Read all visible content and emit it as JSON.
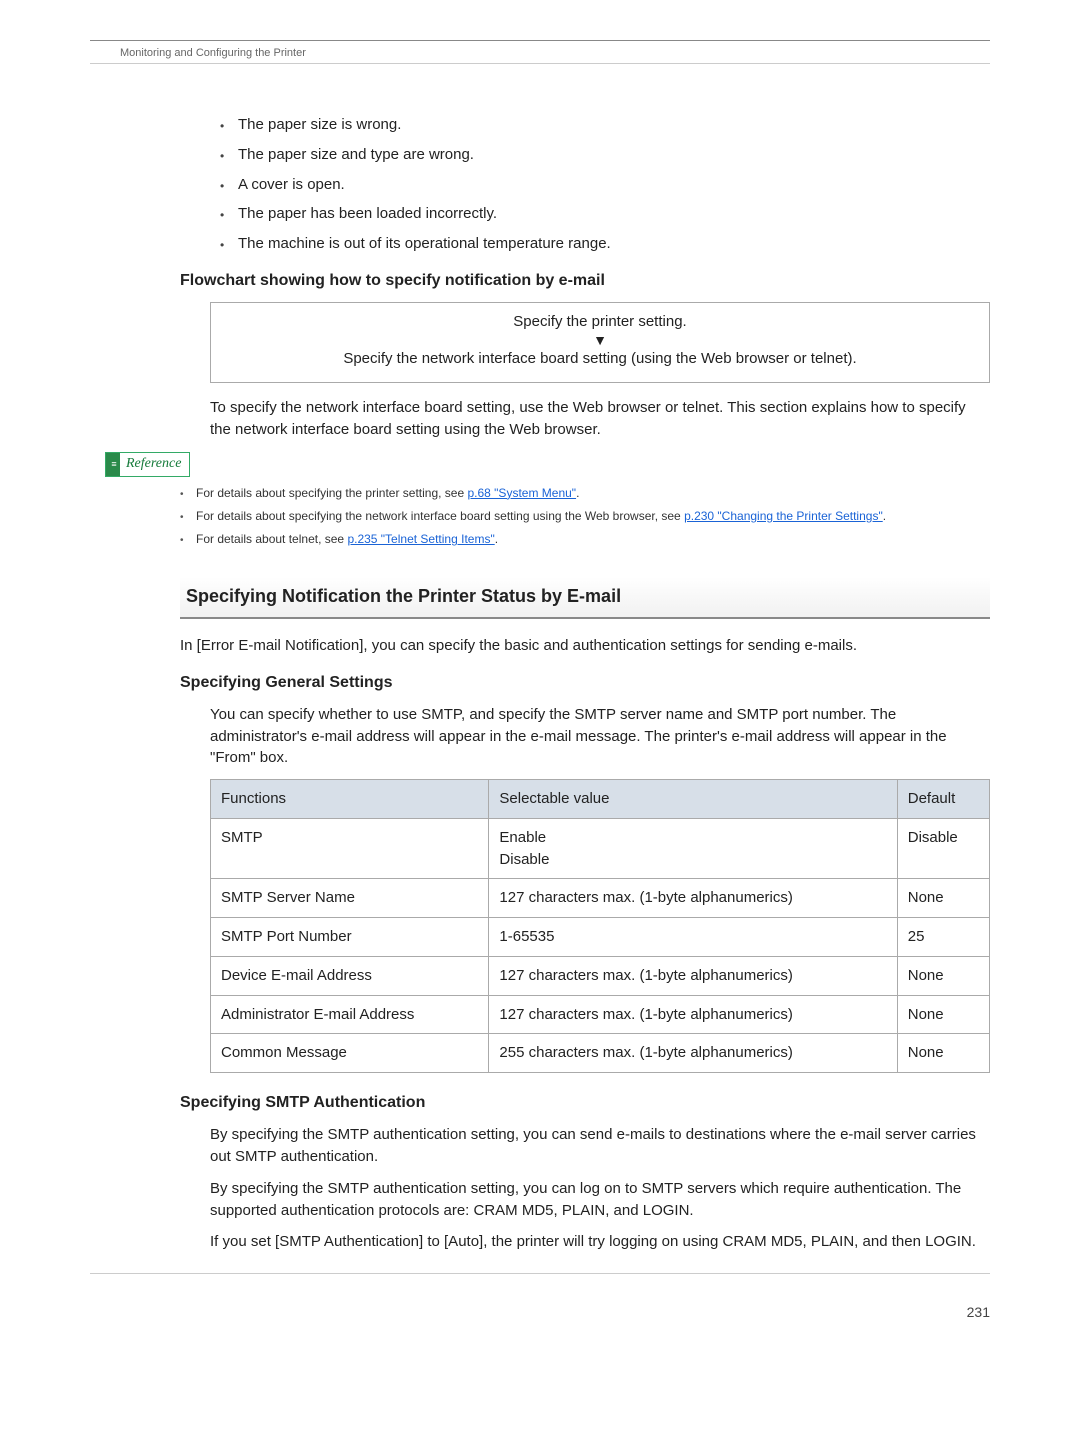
{
  "running_head": "Monitoring and Configuring the Printer",
  "bullets": [
    "The paper size is wrong.",
    "The paper size and type are wrong.",
    "A cover is open.",
    "The paper has been loaded incorrectly.",
    "The machine is out of its operational temperature range."
  ],
  "flowchart_heading": "Flowchart showing how to specify notification by e-mail",
  "flow_step1": "Specify the printer setting.",
  "flow_arrow": "▼",
  "flow_step2": "Specify the network interface board setting (using the Web browser or telnet).",
  "flow_note": "To specify the network interface board setting, use the Web browser or telnet. This section explains how to specify the network interface board setting using the Web browser.",
  "reference_label": "Reference",
  "ref_items": [
    {
      "pre": "For details about specifying the printer setting, see ",
      "link": "p.68 \"System Menu\"",
      "post": "."
    },
    {
      "pre": "For details about specifying the network interface board setting using the Web browser, see ",
      "link": "p.230 \"Changing the Printer Settings\"",
      "post": "."
    },
    {
      "pre": "For details about telnet, see ",
      "link": "p.235 \"Telnet Setting Items\"",
      "post": "."
    }
  ],
  "section_title": "Specifying Notification the Printer Status by E-mail",
  "section_intro": "In [Error E-mail Notification], you can specify the basic and authentication settings for sending e-mails.",
  "general_heading": "Specifying General Settings",
  "general_intro": "You can specify whether to use SMTP, and specify the SMTP server name and SMTP port number. The administrator's e-mail address will appear in the e-mail message. The printer's e-mail address will appear in the \"From\" box.",
  "table_headers": {
    "c1": "Functions",
    "c2": "Selectable value",
    "c3": "Default"
  },
  "table_rows": [
    {
      "c1": "SMTP",
      "c2": "Enable\nDisable",
      "c3": "Disable"
    },
    {
      "c1": "SMTP Server Name",
      "c2": "127 characters max. (1-byte alphanumerics)",
      "c3": "None"
    },
    {
      "c1": "SMTP Port Number",
      "c2": "1-65535",
      "c3": "25"
    },
    {
      "c1": "Device E-mail Address",
      "c2": "127 characters max. (1-byte alphanumerics)",
      "c3": "None"
    },
    {
      "c1": "Administrator E-mail Address",
      "c2": "127 characters max. (1-byte alphanumerics)",
      "c3": "None"
    },
    {
      "c1": "Common Message",
      "c2": "255 characters max. (1-byte alphanumerics)",
      "c3": "None"
    }
  ],
  "smtp_auth_heading": "Specifying SMTP Authentication",
  "smtp_auth_p1": "By specifying the SMTP authentication setting, you can send e-mails to destinations where the e-mail server carries out SMTP authentication.",
  "smtp_auth_p2": "By specifying the SMTP authentication setting, you can log on to SMTP servers which require authentication. The supported authentication protocols are: CRAM MD5, PLAIN, and LOGIN.",
  "smtp_auth_p3": "If you set [SMTP Authentication] to [Auto], the printer will try logging on using CRAM MD5, PLAIN, and then LOGIN.",
  "page_number": "231"
}
